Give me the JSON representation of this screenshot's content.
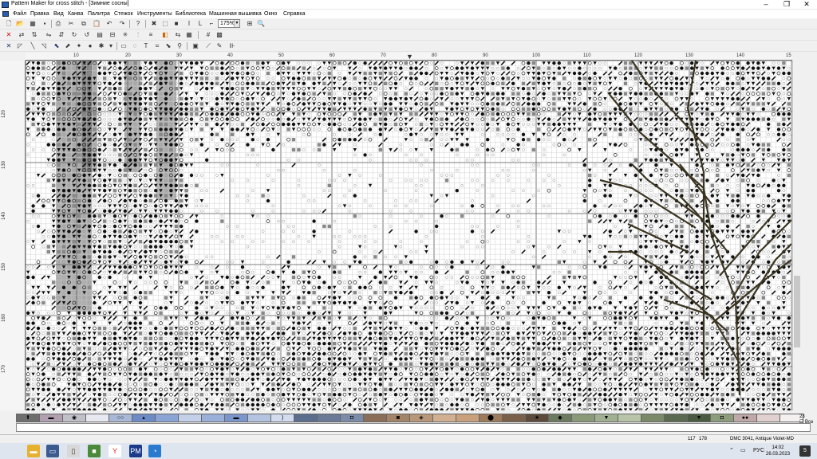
{
  "window": {
    "title": "Pattern Maker for cross stitch - [Зимние сосны]"
  },
  "menu": [
    "Файл",
    "Правка",
    "Вид",
    "Канва",
    "Палитра",
    "Стежок",
    "Инструменты",
    "Библиотека",
    "Машинная вышивка",
    "Окно",
    "Справка"
  ],
  "toolbar": {
    "zoom": "175%"
  },
  "ruler": {
    "h_labels": [
      "10",
      "20",
      "30",
      "40",
      "50",
      "60",
      "70",
      "80",
      "90",
      "100",
      "110",
      "120",
      "130",
      "140",
      "15"
    ],
    "v_labels": [
      "120",
      "130",
      "140",
      "150",
      "160",
      "170"
    ]
  },
  "palette": {
    "colors": [
      "#6e6e6e",
      "#b0a0b0",
      "#c0c0c8",
      "#e8e8f0",
      "#a9b8d6",
      "#6d8bc4",
      "#8aa4d6",
      "#c4d0e8",
      "#9ab0d8",
      "#7a96cc",
      "#b4c4e0",
      "#d2dcee",
      "#5c6e8e",
      "#6a7a96",
      "#7c8ca8",
      "#8a6e58",
      "#a48468",
      "#b8967a",
      "#d0b090",
      "#c8a07c",
      "#9c7a5c",
      "#7a6048",
      "#5c4a3a",
      "#6c7a60",
      "#8a9a78",
      "#a0b090",
      "#b8c4a8",
      "#7a8a68",
      "#5a6a50",
      "#4a5a40",
      "#8c9c7c",
      "#c0a8a8",
      "#e0d0d0",
      "#f4f0f0"
    ],
    "symbols": [
      "⬆",
      "▬",
      "◉",
      "",
      "○○",
      "▴",
      "",
      "",
      "",
      "▬",
      "",
      ")",
      "",
      "",
      "◘",
      "",
      "◙",
      "◈",
      "",
      "",
      "⬤",
      "",
      "★",
      "◆",
      "",
      "▼",
      "",
      "",
      "",
      "▼",
      "◘",
      "●●",
      "",
      ""
    ],
    "right_num": "23",
    "right_check": "Все"
  },
  "status": {
    "x": "117",
    "y": "178",
    "color": "DMC  3041, Antique Violet-MD"
  },
  "taskbar": {
    "lang": "РУС",
    "time": "14:02",
    "date": "26.03.2023",
    "notif": "5"
  }
}
